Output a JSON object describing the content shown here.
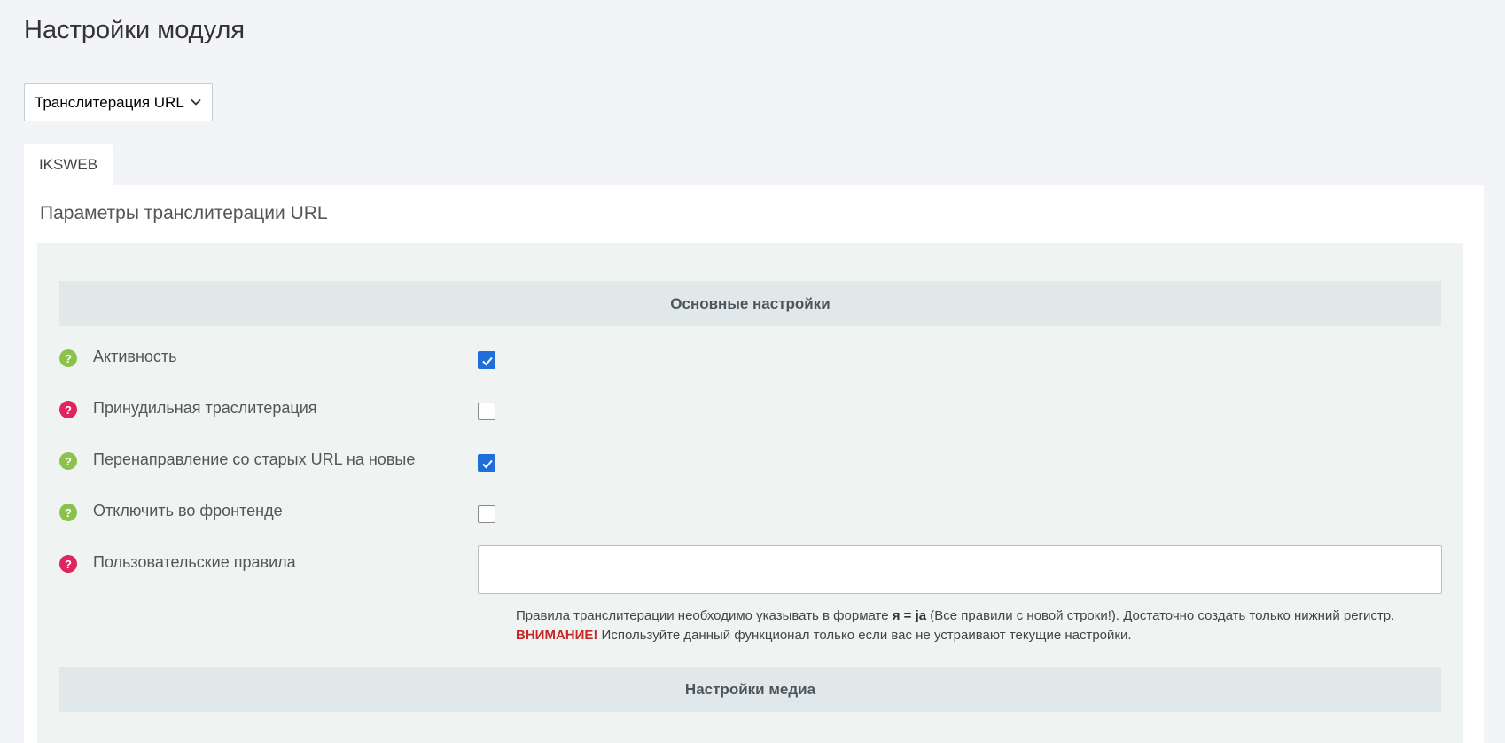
{
  "page": {
    "title": "Настройки модуля"
  },
  "module_select": {
    "value": "Транслитерация URL"
  },
  "tabs": [
    {
      "label": "IKSWEB"
    }
  ],
  "panel": {
    "title": "Параметры транслитерации URL"
  },
  "sections": {
    "main": {
      "heading": "Основные настройки"
    },
    "media": {
      "heading": "Настройки медиа"
    }
  },
  "settings": [
    {
      "label": "Активность",
      "help_color": "green",
      "checked": true
    },
    {
      "label": "Принудильная траслитерация",
      "help_color": "red",
      "checked": false
    },
    {
      "label": "Перенаправление со старых URL на новые",
      "help_color": "green",
      "checked": true
    },
    {
      "label": "Отключить во фронтенде",
      "help_color": "green",
      "checked": false
    },
    {
      "label": "Пользовательские правила",
      "help_color": "red",
      "value": ""
    }
  ],
  "help_icon_glyph": "?",
  "rules_hint": {
    "part1": "Правила транслитерации необходимо указывать в формате ",
    "example": "я = ja",
    "part2": " (Все правили с новой строки!). Достаточно создать только нижний регистр.",
    "warning_label": "ВНИМАНИЕ!",
    "warning_text": " Используйте данный функционал только если вас не устраивают текущие настройки."
  },
  "colors": {
    "help_green": "#8bc34a",
    "help_red": "#e0245e",
    "checkbox_checked": "#1e6fd9",
    "warning": "#c62828"
  }
}
